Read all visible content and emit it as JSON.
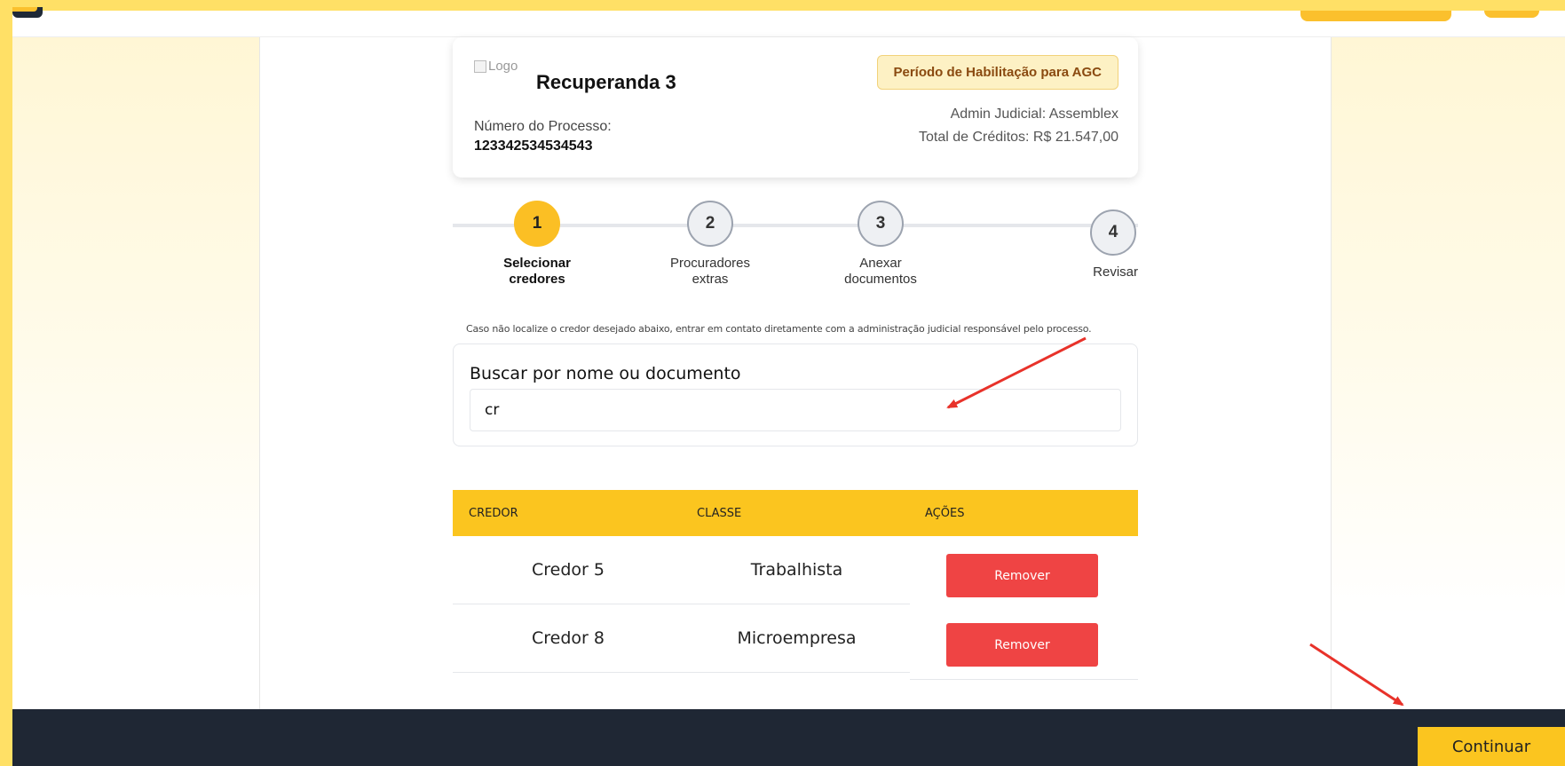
{
  "header": {
    "logo_alt": "Logo",
    "company_name": "Recuperanda 3",
    "process_label": "Número do Processo:",
    "process_number": "123342534534543",
    "period_badge": "Período de Habilitação para AGC",
    "admin": "Admin Judicial: Assemblex",
    "total": "Total de Créditos: R$ 21.547,00"
  },
  "steps": [
    {
      "number": "1",
      "label": "Selecionar credores",
      "active": true
    },
    {
      "number": "2",
      "label": "Procuradores extras",
      "active": false
    },
    {
      "number": "3",
      "label": "Anexar documentos",
      "active": false
    },
    {
      "number": "4",
      "label": "Revisar",
      "active": false
    }
  ],
  "hint": "Caso não localize o credor desejado abaixo, entrar em contato diretamente com a administração judicial responsável pelo processo.",
  "search": {
    "label": "Buscar por nome ou documento",
    "value": "cr"
  },
  "table": {
    "headers": [
      "CREDOR",
      "CLASSE",
      "AÇÕES"
    ],
    "rows": [
      {
        "credor": "Credor 5",
        "classe": "Trabalhista",
        "action": "Remover"
      },
      {
        "credor": "Credor 8",
        "classe": "Microempresa",
        "action": "Remover"
      }
    ]
  },
  "footer": {
    "continue_label": "Continuar"
  },
  "colors": {
    "accent": "#fbc51f",
    "danger": "#ef4444",
    "footer": "#1f2734",
    "annotation_arrow": "#e8322a"
  }
}
